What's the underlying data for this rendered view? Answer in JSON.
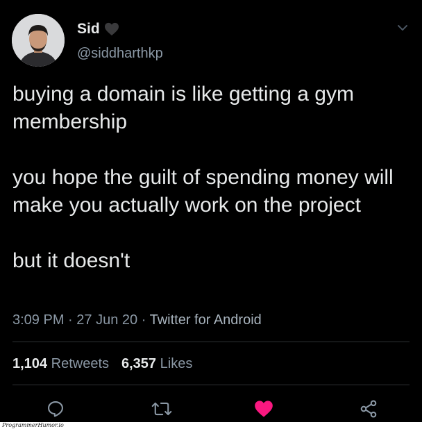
{
  "user": {
    "name": "Sid",
    "handle": "@siddharthkp",
    "avatar_icon": "profile-photo"
  },
  "tweet": {
    "paragraphs": [
      "buying a domain is like getting a gym membership",
      "you hope the guilt of spending money will make you actually work on the project",
      "but it doesn't"
    ],
    "time": "3:09 PM",
    "date": "27 Jun 20",
    "source": "Twitter for Android",
    "separator": "·"
  },
  "stats": {
    "retweets_count": "1,104",
    "retweets_label": "Retweets",
    "likes_count": "6,357",
    "likes_label": "Likes"
  },
  "actions": {
    "reply_icon": "reply-icon",
    "retweet_icon": "retweet-icon",
    "like_icon": "heart-icon",
    "share_icon": "share-icon",
    "liked": true
  },
  "colors": {
    "background": "#000000",
    "primary_text": "#e7e9ea",
    "secondary_text": "#8b98a5",
    "like_red": "#f91880",
    "divider": "#2f3336"
  },
  "watermark": {
    "text": "ProgrammerHumor.io"
  }
}
